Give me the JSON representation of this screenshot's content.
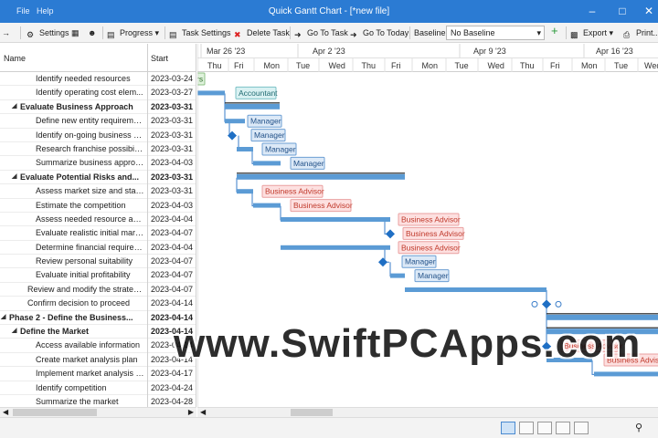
{
  "window": {
    "title": "Quick Gantt Chart - [*new file]",
    "menu": [
      "File",
      "Help"
    ]
  },
  "toolbar": {
    "settings": "Settings",
    "progress": "Progress",
    "task_settings": "Task Settings",
    "delete_task": "Delete Task",
    "go_to_task": "Go To Task",
    "go_to_today": "Go To Today",
    "baseline_label": "Baseline",
    "baseline_value": "No Baseline",
    "export": "Export",
    "print": "Print..."
  },
  "grid": {
    "col_name": "Name",
    "col_start": "Start",
    "rows": [
      {
        "name": "Identify needed resources",
        "start": "2023-03-24",
        "level": 2,
        "summary": false
      },
      {
        "name": "Identify operating cost elem...",
        "start": "2023-03-27",
        "level": 2,
        "summary": false
      },
      {
        "name": "Evaluate Business Approach",
        "start": "2023-03-31",
        "level": 1,
        "summary": true
      },
      {
        "name": "Define new entity requireme...",
        "start": "2023-03-31",
        "level": 2,
        "summary": false
      },
      {
        "name": "Identify on-going business p...",
        "start": "2023-03-31",
        "level": 2,
        "summary": false
      },
      {
        "name": "Research franchise possibilities",
        "start": "2023-03-31",
        "level": 2,
        "summary": false
      },
      {
        "name": "Summarize business approach",
        "start": "2023-04-03",
        "level": 2,
        "summary": false
      },
      {
        "name": "Evaluate Potential Risks and...",
        "start": "2023-03-31",
        "level": 1,
        "summary": true
      },
      {
        "name": "Assess market size and stabil...",
        "start": "2023-03-31",
        "level": 2,
        "summary": false
      },
      {
        "name": "Estimate the competition",
        "start": "2023-04-03",
        "level": 2,
        "summary": false
      },
      {
        "name": "Assess needed resource avail...",
        "start": "2023-04-04",
        "level": 2,
        "summary": false
      },
      {
        "name": "Evaluate realistic initial mark...",
        "start": "2023-04-07",
        "level": 2,
        "summary": false
      },
      {
        "name": "Determine financial requirem...",
        "start": "2023-04-04",
        "level": 2,
        "summary": false
      },
      {
        "name": "Review personal suitability",
        "start": "2023-04-07",
        "level": 2,
        "summary": false
      },
      {
        "name": "Evaluate initial profitability",
        "start": "2023-04-07",
        "level": 2,
        "summary": false
      },
      {
        "name": "Review and modify the strategi...",
        "start": "2023-04-07",
        "level": 1,
        "summary": false
      },
      {
        "name": "Confirm decision to proceed",
        "start": "2023-04-14",
        "level": 1,
        "summary": false
      },
      {
        "name": "Phase 2 - Define the Business...",
        "start": "2023-04-14",
        "level": 0,
        "summary": true
      },
      {
        "name": "Define the Market",
        "start": "2023-04-14",
        "level": 1,
        "summary": true
      },
      {
        "name": "Access available information",
        "start": "2023-04-14",
        "level": 2,
        "summary": false
      },
      {
        "name": "Create market analysis plan",
        "start": "2023-04-14",
        "level": 2,
        "summary": false
      },
      {
        "name": "Implement market analysis p...",
        "start": "2023-04-17",
        "level": 2,
        "summary": false
      },
      {
        "name": "Identify competition",
        "start": "2023-04-24",
        "level": 2,
        "summary": false
      },
      {
        "name": "Summarize the market",
        "start": "2023-04-28",
        "level": 2,
        "summary": false
      }
    ]
  },
  "timeline": {
    "weeks": [
      "Mar 26 '23",
      "Apr 2 '23",
      "Apr 9 '23",
      "Apr 16 '23"
    ],
    "days": [
      "Thu",
      "Fri",
      "Mon",
      "Tue",
      "Wed",
      "Thu",
      "Fri",
      "Mon",
      "Tue",
      "Wed",
      "Thu",
      "Fri",
      "Mon",
      "Tue",
      "Wed"
    ]
  },
  "bars": [
    {
      "row": 0,
      "label": "rs",
      "type": "task",
      "color": "green"
    },
    {
      "row": 1,
      "label": "Accountant",
      "type": "task",
      "color": "teal"
    },
    {
      "row": 2,
      "label": "",
      "type": "summary"
    },
    {
      "row": 3,
      "label": "Manager",
      "type": "task",
      "color": "blue"
    },
    {
      "row": 4,
      "label": "Manager",
      "type": "milestone",
      "color": "blue"
    },
    {
      "row": 5,
      "label": "Manager",
      "type": "task",
      "color": "blue"
    },
    {
      "row": 6,
      "label": "Manager",
      "type": "task",
      "color": "blue"
    },
    {
      "row": 7,
      "label": "",
      "type": "summary"
    },
    {
      "row": 8,
      "label": "Business Advisor",
      "type": "task",
      "color": "red"
    },
    {
      "row": 9,
      "label": "Business Advisor",
      "type": "task",
      "color": "red"
    },
    {
      "row": 10,
      "label": "Business Advisor",
      "type": "task",
      "color": "red"
    },
    {
      "row": 11,
      "label": "Business Advisor",
      "type": "milestone",
      "color": "red"
    },
    {
      "row": 12,
      "label": "Business Advisor",
      "type": "task",
      "color": "red"
    },
    {
      "row": 13,
      "label": "Manager",
      "type": "milestone",
      "color": "blue"
    },
    {
      "row": 14,
      "label": "Manager",
      "type": "task",
      "color": "blue"
    },
    {
      "row": 15,
      "label": "",
      "type": "task",
      "color": "none"
    },
    {
      "row": 16,
      "label": "",
      "type": "milestone",
      "color": "none"
    },
    {
      "row": 17,
      "label": "",
      "type": "summary"
    },
    {
      "row": 18,
      "label": "",
      "type": "summary"
    },
    {
      "row": 19,
      "label": "Business Advisor",
      "type": "milestone",
      "color": "red"
    },
    {
      "row": 20,
      "label": "Business Advisor",
      "type": "task",
      "color": "red"
    }
  ],
  "watermark": "www.SwiftPCApps.com",
  "colors": {
    "titlebar": "#2b7bd3",
    "bar": "#5b9bd5",
    "summary": "#4a90d9",
    "label_blue_bg": "#dce9f7",
    "label_teal_bg": "#d9f1f2",
    "label_red_bg": "#fde0e0",
    "label_red_text": "#c0392b"
  }
}
